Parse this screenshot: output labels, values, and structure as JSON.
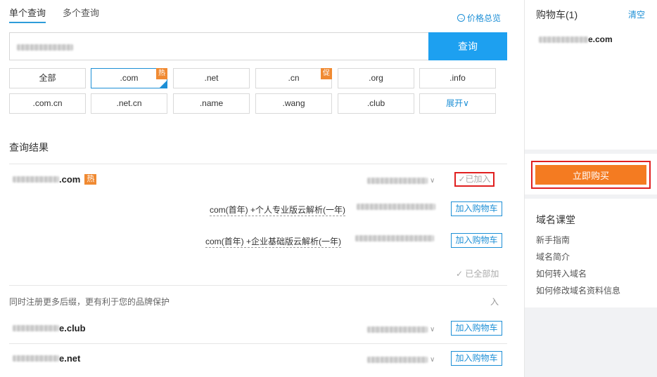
{
  "tabs": [
    "单个查询",
    "多个查询"
  ],
  "price_overview": "价格总览",
  "price_icon": "arrow-circle-icon",
  "search": {
    "button": "查询"
  },
  "tlds": [
    {
      "label": "全部"
    },
    {
      "label": ".com",
      "badge": "热"
    },
    {
      "label": ".net"
    },
    {
      "label": ".cn",
      "badge": "促"
    },
    {
      "label": ".org"
    },
    {
      "label": ".info"
    },
    {
      "label": ".com.cn"
    },
    {
      "label": ".net.cn"
    },
    {
      "label": ".name"
    },
    {
      "label": ".wang"
    },
    {
      "label": ".club"
    },
    {
      "label": "展开"
    }
  ],
  "expand_chevron": "∨",
  "results_title": "查询结果",
  "main_result": {
    "domain_suffix": ".com",
    "hot": "热",
    "added": "已加入"
  },
  "bundles": [
    {
      "text": "com(首年) +个人专业版云解析(一年)",
      "button": "加入购物车"
    },
    {
      "text": "com(首年) +企业基础版云解析(一年)",
      "button": "加入购物车"
    }
  ],
  "all_added": "已全部加",
  "more_tip": "同时注册更多后缀，更有利于您的品牌保护",
  "more_right": "入",
  "other_results": [
    {
      "domain_suffix": "e.club",
      "button": "加入购物车"
    },
    {
      "domain_suffix": "e.net",
      "button": "加入购物车"
    }
  ],
  "cart": {
    "title": "购物车(1)",
    "clear": "清空",
    "item_suffix": "e.com",
    "buy": "立即购买"
  },
  "course": {
    "title": "域名课堂",
    "links": [
      "新手指南",
      "域名简介",
      "如何转入域名",
      "如何修改域名资料信息"
    ]
  },
  "colors": {
    "accent": "#1da0f0",
    "buy": "#f47b21",
    "hot": "#f08a32",
    "highlight": "#e02020"
  }
}
